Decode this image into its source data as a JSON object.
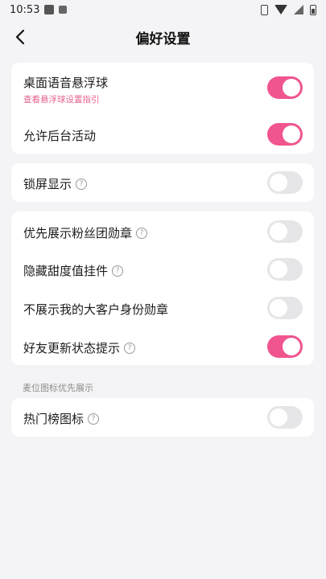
{
  "status_bar": {
    "time": "10:53"
  },
  "header": {
    "title": "偏好设置"
  },
  "cards": [
    {
      "rows": [
        {
          "label": "桌面语音悬浮球",
          "sub": "查看悬浮球设置指引",
          "toggle": true,
          "help": false
        },
        {
          "label": "允许后台活动",
          "toggle": true,
          "help": false
        }
      ]
    },
    {
      "rows": [
        {
          "label": "锁屏显示",
          "toggle": false,
          "help": true
        }
      ]
    },
    {
      "rows": [
        {
          "label": "优先展示粉丝团勋章",
          "toggle": false,
          "help": true
        },
        {
          "label": "隐藏甜度值挂件",
          "toggle": false,
          "help": true
        },
        {
          "label": "不展示我的大客户身份勋章",
          "toggle": false,
          "help": false
        },
        {
          "label": "好友更新状态提示",
          "toggle": true,
          "help": true
        }
      ]
    },
    {
      "caption": "麦位图标优先展示",
      "rows": [
        {
          "label": "热门榜图标",
          "toggle": false,
          "help": true
        }
      ]
    }
  ],
  "colors": {
    "accent": "#f0558f",
    "toggle_off": "#e6e6e8",
    "sub_link": "#e5608d"
  },
  "icons": {
    "back": "chevron-left-icon",
    "help": "question-circle-icon",
    "help_glyph": "?"
  }
}
